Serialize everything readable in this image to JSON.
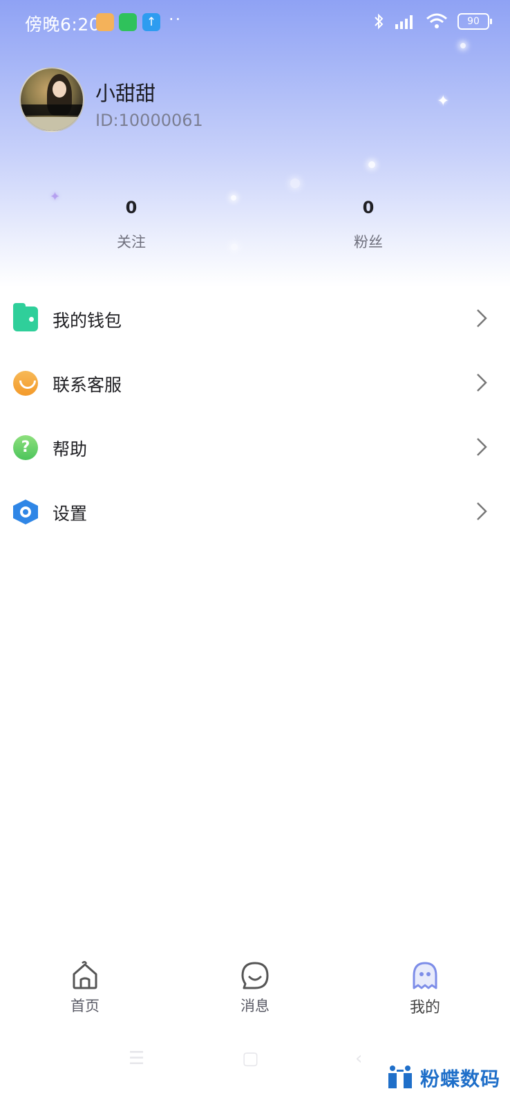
{
  "status_bar": {
    "time": "傍晚6:20",
    "more_dots": "··",
    "battery": "90",
    "upload_glyph": "↑"
  },
  "profile": {
    "name": "小甜甜",
    "id_text": "ID:10000061"
  },
  "stats": [
    {
      "value": "0",
      "label": "关注"
    },
    {
      "value": "0",
      "label": "粉丝"
    }
  ],
  "menu": [
    {
      "label": "我的钱包",
      "icon": "wallet-icon"
    },
    {
      "label": "联系客服",
      "icon": "customer-service-icon"
    },
    {
      "label": "帮助",
      "icon": "help-icon",
      "glyph": "?"
    },
    {
      "label": "设置",
      "icon": "settings-icon"
    }
  ],
  "tabs": [
    {
      "label": "首页",
      "icon": "home-icon"
    },
    {
      "label": "消息",
      "icon": "message-icon"
    },
    {
      "label": "我的",
      "icon": "profile-ghost-icon",
      "active": true
    }
  ],
  "watermark": {
    "text": "粉蝶数码"
  },
  "colors": {
    "header_gradient_top": "#8fa2f4",
    "wallet": "#2fcf9a",
    "service": "#f39a2a",
    "help": "#4cc45b",
    "settings": "#2f86e6",
    "active_tab": "#7d8de8",
    "watermark": "#1f6fc9"
  }
}
